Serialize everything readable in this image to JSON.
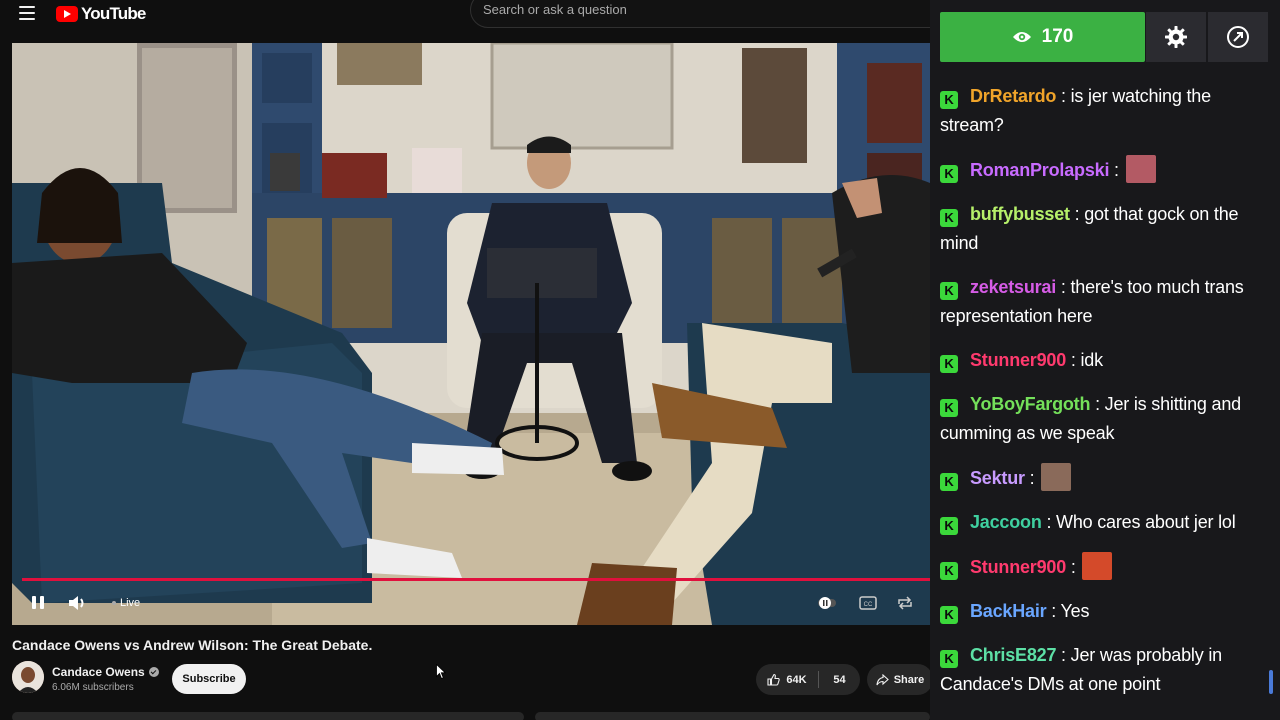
{
  "topbar": {
    "logo_text": "YouTube",
    "search_placeholder": "Search or ask a question"
  },
  "player": {
    "live_label": "Live",
    "progress_color": "#e0103d"
  },
  "video_info": {
    "title": "Candace Owens vs Andrew Wilson: The Great Debate.",
    "channel_name": "Candace Owens",
    "subscribers": "6.06M subscribers",
    "subscribe_label": "Subscribe",
    "likes": "64K",
    "dislikes": "54",
    "share_label": "Share"
  },
  "chat": {
    "viewer_count": "170",
    "accent_color": "#3bb143",
    "messages": [
      {
        "user": "DrRetardo",
        "color": "#f0a42a",
        "text": "is jer watching the stream?"
      },
      {
        "user": "RomanProlapski",
        "color": "#c86bff",
        "text": ""
      },
      {
        "user": "buffybusset",
        "color": "#b6f06a",
        "text": "got that gock on the mind"
      },
      {
        "user": "zeketsurai",
        "color": "#d65ce6",
        "text": "there's too much trans representation here"
      },
      {
        "user": "Stunner900",
        "color": "#ff3a6e",
        "text": "idk"
      },
      {
        "user": "YoBoyFargoth",
        "color": "#74e05a",
        "text": "Jer is shitting and cumming as we speak"
      },
      {
        "user": "Sektur",
        "color": "#c89bff",
        "text": ""
      },
      {
        "user": "Jaccoon",
        "color": "#3fd0a0",
        "text": "Who cares about jer lol"
      },
      {
        "user": "Stunner900",
        "color": "#ff3a6e",
        "text": ""
      },
      {
        "user": "BackHair",
        "color": "#6aa6ff",
        "text": "Yes"
      },
      {
        "user": "ChrisE827",
        "color": "#5de0a6",
        "text": "Jer was probably in Candace's DMs at one point"
      }
    ]
  }
}
